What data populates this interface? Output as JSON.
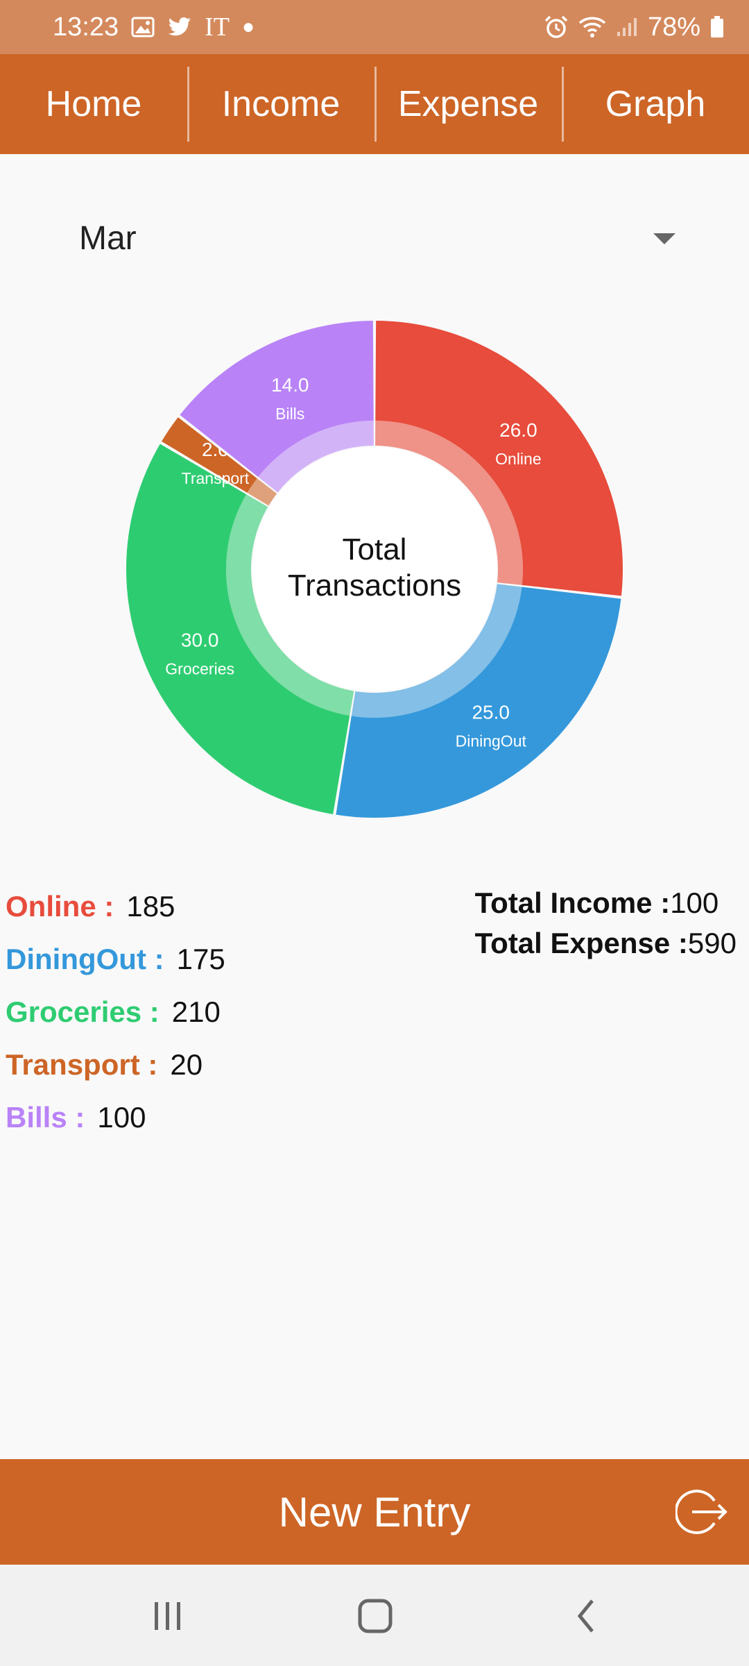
{
  "status_bar": {
    "time": "13:23",
    "carrier": "IT",
    "battery": "78%"
  },
  "tabs": [
    {
      "label": "Home"
    },
    {
      "label": "Income"
    },
    {
      "label": "Expense"
    },
    {
      "label": "Graph"
    }
  ],
  "month_select": {
    "value": "Mar"
  },
  "chart_data": {
    "type": "pie",
    "donut": true,
    "center_text": [
      "Total",
      "Transactions"
    ],
    "categories": [
      "Online",
      "DiningOut",
      "Groceries",
      "Transport",
      "Bills"
    ],
    "values": [
      26.0,
      25.0,
      30.0,
      2.0,
      14.0
    ],
    "value_labels": [
      "26.0",
      "25.0",
      "30.0",
      "2.0",
      "14.0"
    ],
    "colors": [
      "#e74c3c",
      "#3498db",
      "#2ecc71",
      "#cd6526",
      "#b983f7"
    ]
  },
  "legend": [
    {
      "label": "Online :",
      "value": "185",
      "color": "#e74c3c"
    },
    {
      "label": "DiningOut :",
      "value": "175",
      "color": "#3498db"
    },
    {
      "label": "Groceries :",
      "value": "210",
      "color": "#2ecc71"
    },
    {
      "label": "Transport :",
      "value": "20",
      "color": "#cd6526"
    },
    {
      "label": "Bills :",
      "value": "100",
      "color": "#b983f7"
    }
  ],
  "totals": {
    "income_label": "Total Income :",
    "income_value": "100",
    "expense_label": "Total Expense :",
    "expense_value": "590"
  },
  "bottom_bar": {
    "new_entry_label": "New Entry",
    "logout_icon": "logout-icon"
  },
  "system_nav": {
    "recents_icon": "recents-icon",
    "home_icon": "home-icon",
    "back_icon": "back-icon"
  }
}
